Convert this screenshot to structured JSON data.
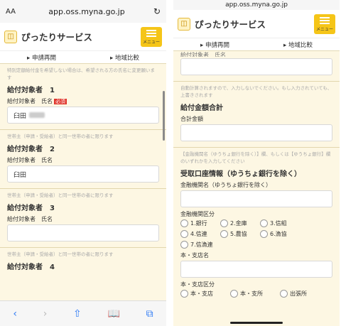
{
  "browser": {
    "aa": "AA",
    "url": "app.oss.myna.go.jp",
    "reload": "↻"
  },
  "header": {
    "brand": "ぴったりサービス",
    "menu_label": "メニュー"
  },
  "subnav": {
    "resume": "▸ 申請再開",
    "compare": "▸ 地域比較"
  },
  "left": {
    "top_note": "特別定額給付金を希望しない場合は、希望される方の氏名に変更願います",
    "p1_heading": "給付対象者　1",
    "p1_label": "給付対象者　氏名",
    "required": "必須",
    "p1_value": "臼田",
    "p2_note": "世帯主（申請・受給者）と同一世帯の者に限ります",
    "p2_heading": "給付対象者　2",
    "p2_label": "給付対象者　氏名",
    "p2_value": "臼田",
    "p3_note": "世帯主（申請・受給者）と同一世帯の者に限ります",
    "p3_heading": "給付対象者　3",
    "p3_label": "給付対象者　氏名",
    "p4_note": "世帯主（申請・受給者）と同一世帯の者に限ります",
    "p4_heading": "給付対象者　4"
  },
  "right": {
    "top_label": "給付対象者　氏名",
    "auto_note": "自動計算されますので、入力しないでください。もし入力されていても、上書きされます",
    "total_heading": "給付金額合計",
    "total_label": "合計金額",
    "bank_note": "【金融機関名（ゆうちょ銀行を除く）】欄、もしくは【ゆうちょ銀行】欄のいずれかを入力してください",
    "bank_heading": "受取口座情報（ゆうちょ銀行を除く）",
    "bank_name_label": "金融機関名（ゆうちょ銀行を除く）",
    "bank_type_label": "金融機関区分",
    "bank_types": [
      "1.銀行",
      "2.金庫",
      "3.信組",
      "4.信連",
      "5.農協",
      "6.漁協",
      "7.信漁連"
    ],
    "branch_label": "本・支店名",
    "branch_type_label": "本・支店区分",
    "branch_types": [
      "本・支店",
      "本・支所",
      "出張所"
    ]
  },
  "toolbar": {
    "back": "‹",
    "forward": "›",
    "share": "⇧",
    "bookmarks": "📖",
    "tabs": "⧉"
  }
}
